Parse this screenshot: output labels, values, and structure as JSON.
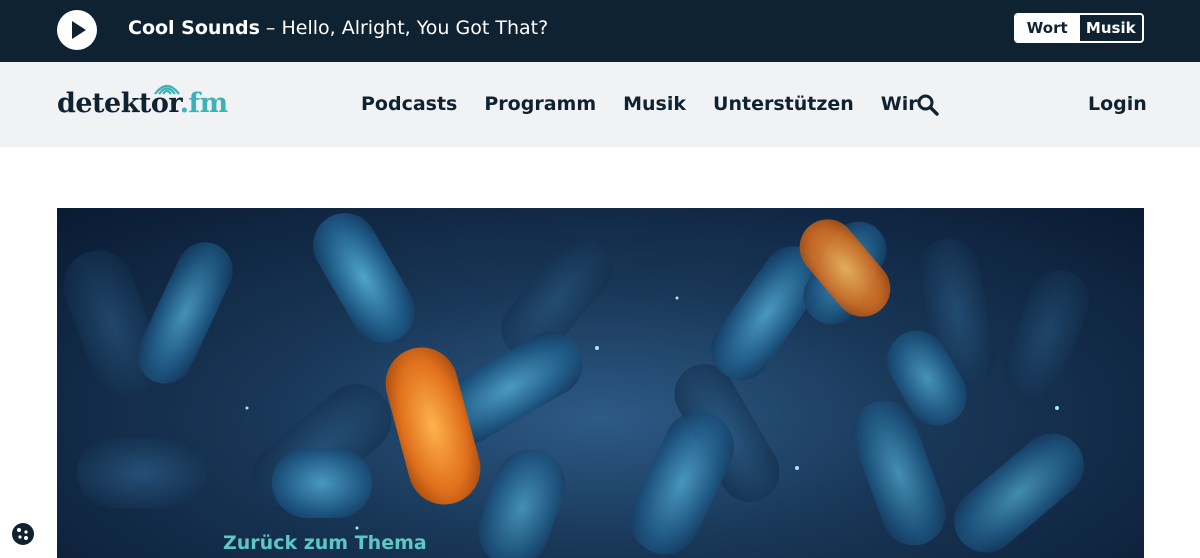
{
  "player": {
    "artist": "Cool Sounds",
    "separator": " – ",
    "track": "Hello, Alright, You Got That?",
    "toggle": {
      "wort": "Wort",
      "musik": "Musik",
      "active": "Wort"
    }
  },
  "nav": {
    "logo": {
      "main": "detektor",
      "dot_fm": ".fm"
    },
    "items": [
      "Podcasts",
      "Programm",
      "Musik",
      "Unterstützen",
      "Wir"
    ],
    "search_icon": "search-icon",
    "login": "Login"
  },
  "hero": {
    "image": "blue and orange bacteria illustration",
    "back_link": "Zurück zum Thema"
  },
  "colors": {
    "player_bg": "#0f2231",
    "nav_bg": "#f1f2f4",
    "brand_dark": "#0f2231",
    "brand_teal": "#39b3b3",
    "link_teal": "#5cc7c4"
  },
  "cookie_icon": "cookie-icon"
}
